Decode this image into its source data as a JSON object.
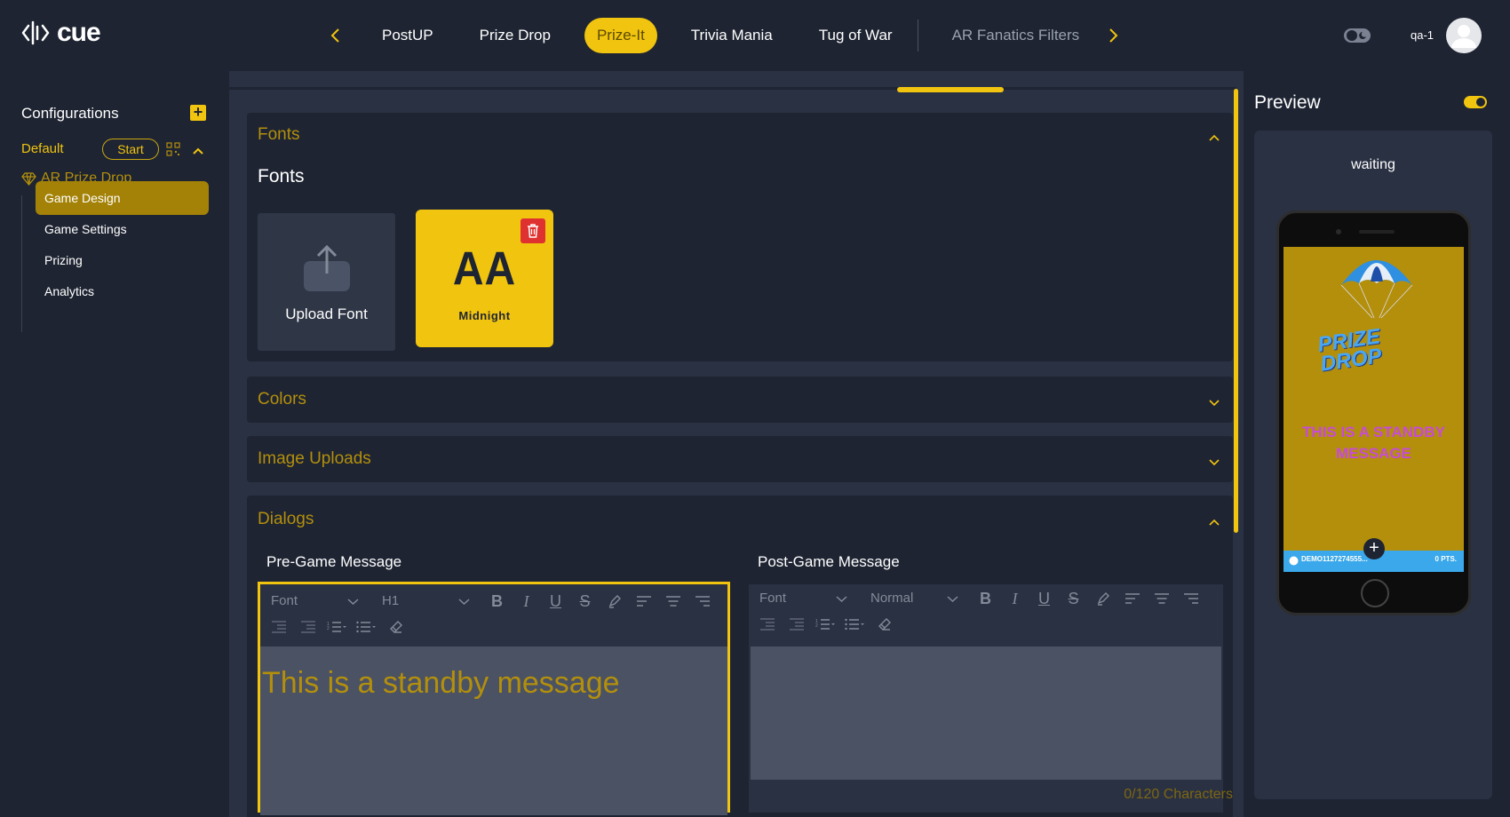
{
  "header": {
    "logo_text": "cue",
    "tabs": [
      {
        "label": "PostUP"
      },
      {
        "label": "Prize Drop"
      },
      {
        "label": "Prize-It"
      },
      {
        "label": "Trivia Mania"
      },
      {
        "label": "Tug of War"
      },
      {
        "label": "AR Fanatics Filters"
      }
    ],
    "active_tab": "Prize-It",
    "user_name": "qa-1"
  },
  "sidebar": {
    "title": "Configurations",
    "config_name": "Default",
    "start_label": "Start",
    "app_name": "AR Prize Drop",
    "items": [
      {
        "label": "Game Design",
        "active": true
      },
      {
        "label": "Game Settings",
        "active": false
      },
      {
        "label": "Prizing",
        "active": false
      },
      {
        "label": "Analytics",
        "active": false
      }
    ]
  },
  "main": {
    "fonts": {
      "title": "Fonts",
      "subtitle": "Fonts",
      "upload_label": "Upload Font",
      "font_preview": "AA",
      "font_name": "Midnight"
    },
    "colors_title": "Colors",
    "image_uploads_title": "Image Uploads",
    "dialogs": {
      "title": "Dialogs",
      "pre_game": {
        "label": "Pre-Game Message",
        "font_select": "Font",
        "size_select": "H1",
        "text": "This is a standby message"
      },
      "post_game": {
        "label": "Post-Game Message",
        "font_select": "Font",
        "size_select": "Normal",
        "text": "",
        "char_count": "0/120 Characters"
      }
    }
  },
  "preview": {
    "title": "Preview",
    "status": "waiting",
    "logo_line1": "PRIZE",
    "logo_line2": "DROP",
    "standby_message": "THIS IS A STANDBY MESSAGE",
    "bar_left": "DEMO1127274555...",
    "bar_right": "0 PTS."
  },
  "colors": {
    "accent": "#f1c40f",
    "accent_dark": "#b38f0c",
    "background": "#1e2432",
    "panel": "#2a3142",
    "standby_preview_text": "#c84bd8"
  }
}
